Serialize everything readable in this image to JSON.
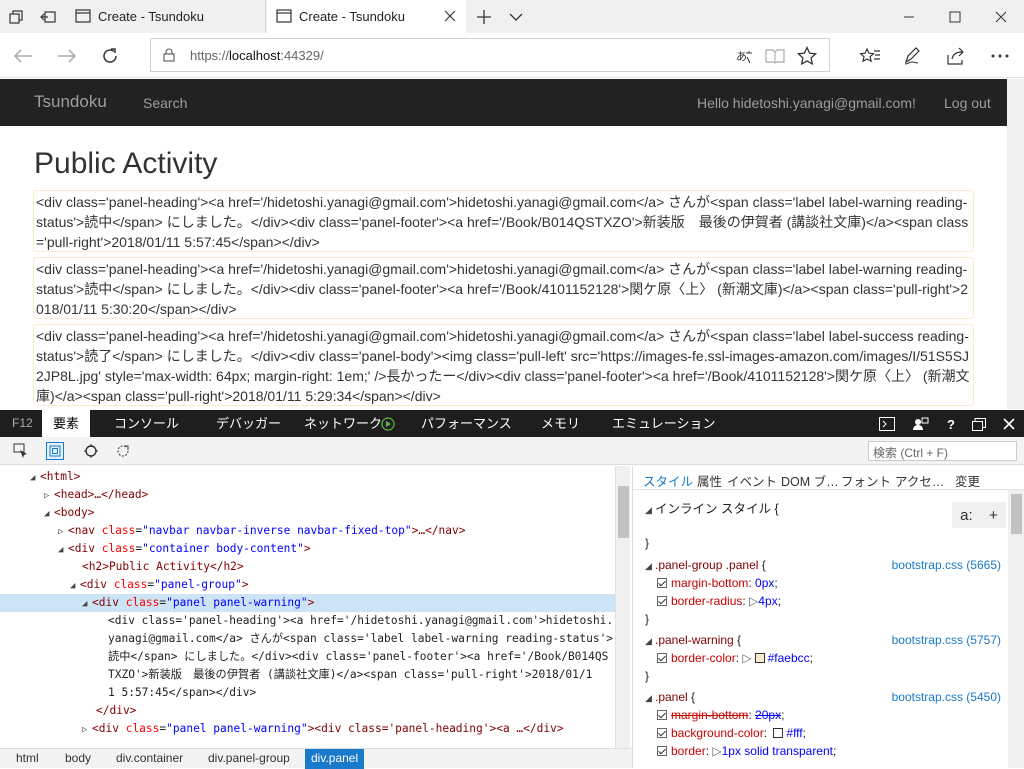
{
  "window": {
    "tabs": [
      {
        "label": "Create - Tsundoku"
      },
      {
        "label": "Create - Tsundoku"
      }
    ]
  },
  "address": {
    "url_prefix": "https://",
    "url_host": "localhost",
    "url_port": ":44329/"
  },
  "site": {
    "brand": "Tsundoku",
    "nav_search": "Search",
    "hello": "Hello hidetoshi.yanagi@gmail.com!",
    "logout": "Log out",
    "heading": "Public Activity",
    "panels": [
      "<div class='panel-heading'><a href='/hidetoshi.yanagi@gmail.com'>hidetoshi.yanagi@gmail.com</a> さんが<span class='label label-warning reading-status'>読中</span> にしました。</div><div class='panel-footer'><a href='/Book/B014QSTXZO'>新装版　最後の伊賀者 (講談社文庫)</a><span class='pull-right'>2018/01/11 5:57:45</span></div>",
      "<div class='panel-heading'><a href='/hidetoshi.yanagi@gmail.com'>hidetoshi.yanagi@gmail.com</a> さんが<span class='label label-warning reading-status'>読中</span> にしました。</div><div class='panel-footer'><a href='/Book/4101152128'>関ケ原〈上〉 (新潮文庫)</a><span class='pull-right'>2018/01/11 5:30:20</span></div>",
      "<div class='panel-heading'><a href='/hidetoshi.yanagi@gmail.com'>hidetoshi.yanagi@gmail.com</a> さんが<span class='label label-success reading-status'>読了</span> にしました。</div><div class='panel-body'><img class='pull-left' src='https://images-fe.ssl-images-amazon.com/images/I/51S5SJ2JP8L.jpg' style='max-width: 64px; margin-right: 1em;' />長かったー</div><div class='panel-footer'><a href='/Book/4101152128'>関ケ原〈上〉 (新潮文庫)</a><span class='pull-right'>2018/01/11 5:29:34</span></div>"
    ]
  },
  "devtools": {
    "f12": "F12",
    "tabs": [
      "要素",
      "コンソール",
      "デバッガー",
      "ネットワーク",
      "パフォーマンス",
      "メモリ",
      "エミュレーション"
    ],
    "search_placeholder": "検索 (Ctrl + F)",
    "dom": {
      "html": "<html>",
      "head": "<head>…</head>",
      "body": "<body>",
      "nav_open": "<nav",
      "nav_class": "navbar navbar-inverse navbar-fixed-top",
      "nav_close": ">…</nav>",
      "div": "<div",
      "container_class": "container body-content",
      "h2": "<h2>Public Activity</h2>",
      "panelgroup_class": "panel-group",
      "panel_class": "panel panel-warning",
      "inner_lines": [
        "<div class='panel-heading'><a href='/hidetoshi.yanagi@gmail.com'>hidetoshi.",
        "yanagi@gmail.com</a> さんが<span class='label label-warning reading-status'>",
        "読中</span> にしました。</div><div class='panel-footer'><a href='/Book/B014QS",
        "TXZO'>新装版　最後の伊賀者 (講談社文庫)</a><span class='pull-right'>2018/01/1",
        "1 5:57:45</span></div>"
      ],
      "div_close": "</div>",
      "last_tail": "><div class='panel-heading'><a …</div>"
    },
    "crumbs": [
      "html",
      "body",
      "div.container",
      "div.panel-group",
      "div.panel"
    ],
    "style_tabs": [
      "スタイル",
      "属性",
      "イベント",
      "DOM ブ…",
      "フォント",
      "アクセ…",
      "変更"
    ],
    "inline_label": "インライン スタイル",
    "rules": [
      {
        "selector": ".panel-group .panel",
        "source": "bootstrap.css (5665)",
        "props": [
          [
            "margin-bottom",
            "0px"
          ],
          [
            "border-radius",
            "4px"
          ]
        ]
      },
      {
        "selector": ".panel-warning",
        "source": "bootstrap.css (5757)",
        "props": [
          [
            "border-color",
            "#faebcc"
          ]
        ]
      },
      {
        "selector": ".panel",
        "source": "bootstrap.css (5450)",
        "props": [
          [
            "margin-bottom",
            "20px"
          ],
          [
            "background-color",
            "#fff"
          ],
          [
            "border",
            "1px solid transparent"
          ]
        ]
      }
    ],
    "colors": {
      "swatch1": "#faebcc",
      "swatch2": "#fff",
      "accent": "#1979ca"
    }
  }
}
